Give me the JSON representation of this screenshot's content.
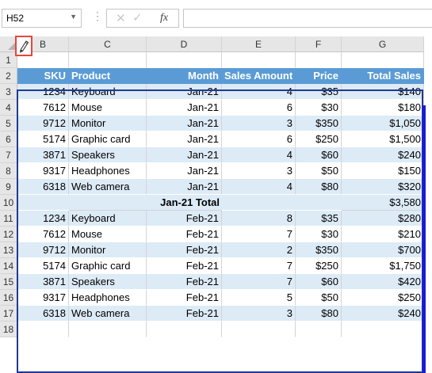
{
  "formula_bar": {
    "name_box": "H52",
    "fx_label": "fx",
    "formula": ""
  },
  "columns": [
    "B",
    "C",
    "D",
    "E",
    "F",
    "G"
  ],
  "rows": [
    "1",
    "2",
    "3",
    "4",
    "5",
    "6",
    "7",
    "8",
    "9",
    "10",
    "11",
    "12",
    "13",
    "14",
    "15",
    "16",
    "17",
    "18"
  ],
  "table": {
    "headers": [
      "SKU",
      "Product",
      "Month",
      "Sales Amount",
      "Price",
      "Total Sales"
    ],
    "rows": [
      [
        "1234",
        "Keyboard",
        "Jan-21",
        "4",
        "$35",
        "$140"
      ],
      [
        "7612",
        "Mouse",
        "Jan-21",
        "6",
        "$30",
        "$180"
      ],
      [
        "9712",
        "Monitor",
        "Jan-21",
        "3",
        "$350",
        "$1,050"
      ],
      [
        "5174",
        "Graphic card",
        "Jan-21",
        "6",
        "$250",
        "$1,500"
      ],
      [
        "3871",
        "Speakers",
        "Jan-21",
        "4",
        "$60",
        "$240"
      ],
      [
        "9317",
        "Headphones",
        "Jan-21",
        "3",
        "$50",
        "$150"
      ],
      [
        "6318",
        "Web camera",
        "Jan-21",
        "4",
        "$80",
        "$320"
      ]
    ],
    "subtotal": {
      "label": "Jan-21 Total",
      "value": "$3,580"
    },
    "rows2": [
      [
        "1234",
        "Keyboard",
        "Feb-21",
        "8",
        "$35",
        "$280"
      ],
      [
        "7612",
        "Mouse",
        "Feb-21",
        "7",
        "$30",
        "$210"
      ],
      [
        "9712",
        "Monitor",
        "Feb-21",
        "2",
        "$350",
        "$700"
      ],
      [
        "5174",
        "Graphic card",
        "Feb-21",
        "7",
        "$250",
        "$1,750"
      ],
      [
        "3871",
        "Speakers",
        "Feb-21",
        "7",
        "$60",
        "$420"
      ],
      [
        "9317",
        "Headphones",
        "Feb-21",
        "5",
        "$50",
        "$250"
      ],
      [
        "6318",
        "Web camera",
        "Feb-21",
        "3",
        "$80",
        "$240"
      ]
    ]
  },
  "colors": {
    "header_fill": "#5b9bd5",
    "band_fill": "#ddebf7",
    "highlight_border": "#e5463d"
  }
}
